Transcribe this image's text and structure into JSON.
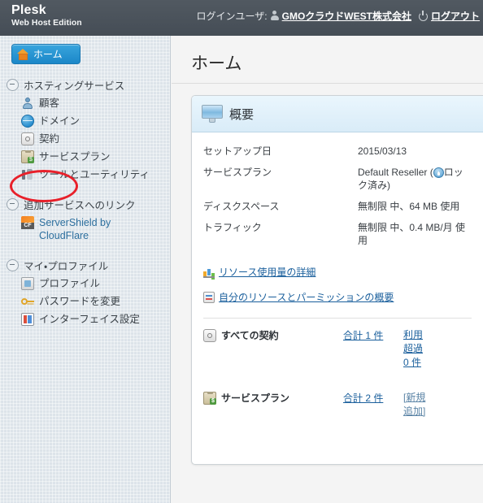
{
  "header": {
    "brand_name": "Plesk",
    "brand_sub": "Web Host Edition",
    "login_label": "ログインユーザ:",
    "user_name": "GMOクラウドWEST株式会社",
    "logout_label": "ログアウト",
    "user_icon": "user-icon",
    "power_icon": "power-icon",
    "bg_color": "#4a525b"
  },
  "sidebar": {
    "home_button": {
      "label": "ホーム",
      "icon": "home-icon"
    },
    "groups": [
      {
        "label": "ホスティングサービス",
        "toggle_icon": "collapse-minus-icon",
        "items": [
          {
            "label": "顧客",
            "icon": "customer-icon"
          },
          {
            "label": "ドメイン",
            "icon": "globe-icon"
          },
          {
            "label": "契約",
            "icon": "subscription-icon"
          },
          {
            "label": "サービスプラン",
            "icon": "service-plan-icon"
          },
          {
            "label": "ツールとユーティリティ",
            "icon": "tools-icon"
          }
        ]
      },
      {
        "label": "追加サービスへのリンク",
        "toggle_icon": "collapse-minus-icon",
        "items": [
          {
            "label": "ServerShield by CloudFlare",
            "icon": "cloudflare-icon"
          }
        ]
      },
      {
        "label": "マイ・プロファイル",
        "toggle_icon": "collapse-minus-icon",
        "items": [
          {
            "label": "プロファイル",
            "icon": "profile-icon"
          },
          {
            "label": "パスワードを変更",
            "icon": "key-icon"
          },
          {
            "label": "インターフェイス設定",
            "icon": "interface-settings-icon"
          }
        ]
      }
    ],
    "annotation": {
      "shape": "ellipse",
      "color": "#e8202a",
      "target": "契約"
    }
  },
  "main": {
    "page_title": "ホーム",
    "panel": {
      "title": "概要",
      "icon": "monitor-icon",
      "info_rows": [
        {
          "label": "セットアップ日",
          "value": "2015/03/13"
        },
        {
          "label": "サービスプラン",
          "value_prefix": "Default Reseller (",
          "value_icon": "lock-icon",
          "value_suffix": "ロック済み)"
        },
        {
          "label": "ディスクスペース",
          "value": "無制限 中、64 MB 使用"
        },
        {
          "label": "トラフィック",
          "value": "無制限 中、0.4 MB/月 使用"
        }
      ],
      "links": [
        {
          "label": "リソース使用量の詳細",
          "icon": "chart-icon"
        },
        {
          "label": "自分のリソースとパーミッションの概要",
          "icon": "list-icon"
        }
      ],
      "stats": [
        {
          "name": "すべての契約",
          "icon": "subscription-icon",
          "total": "合計 1 件",
          "extra": "利用超過 0 件",
          "extra_muted": false
        },
        {
          "name": "サービスプラン",
          "icon": "service-plan-icon",
          "total": "合計 2 件",
          "extra": "[新規追加]",
          "extra_muted": true
        }
      ]
    }
  }
}
